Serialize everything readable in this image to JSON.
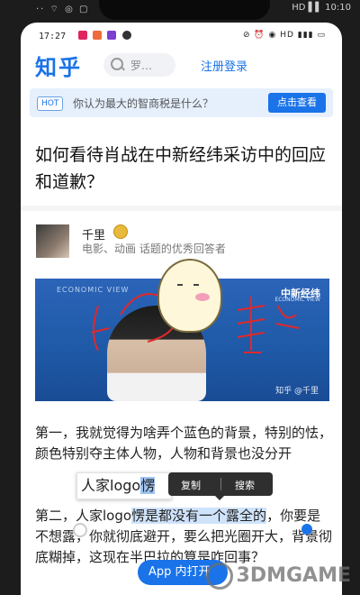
{
  "outer_status": {
    "left": "·· ⌔ ◎ ▢",
    "right": "HD ▌▌ 10:10"
  },
  "status_bar": {
    "time": "17:27",
    "system": "⊘ ⏰ ◉ HD ▮▮▮ ▭"
  },
  "header": {
    "logo": "知乎",
    "search_placeholder": "罗…",
    "login": "注册登录"
  },
  "hot_banner": {
    "badge": "HOT",
    "text": "你认为最大的智商税是什么？",
    "button": "点击查看"
  },
  "question": {
    "title": "如何看待肖战在中新经纬采访中的回应和道歉？"
  },
  "answer": {
    "author_name": "千里",
    "author_desc": "电影、动画 话题的优秀回答者",
    "video": {
      "brand_left": "ECONOMIC VIEW",
      "brand_right": "中新经纬",
      "brand_sub": "ECONOMIC VIEW",
      "watermark": "知乎 @千里"
    },
    "paragraph1": "第一，我就觉得为啥弄个蓝色的背景，特别的怯，颜色特别夺主体人物，人物和背景也没分开",
    "paragraph2_pre": "第二，人家logo",
    "paragraph2_hl": "愣是都没有一个露全的",
    "paragraph2_post": "，你要是不想露，你就彻底避开，要么把光圈开大，背景彻底糊掉，这现在半巴拉的算是咋回事？"
  },
  "selection": {
    "label_pre": "人家logo",
    "label_hl": "愣"
  },
  "context_menu": {
    "copy": "复制",
    "search": "搜索"
  },
  "app_button": {
    "label": "App 内打开"
  },
  "watermark": {
    "text": "3DMGAME"
  },
  "colors": {
    "accent": "#1a73e8",
    "highlight": "#cfe3fb",
    "menu_bg": "#2f2f2f"
  }
}
